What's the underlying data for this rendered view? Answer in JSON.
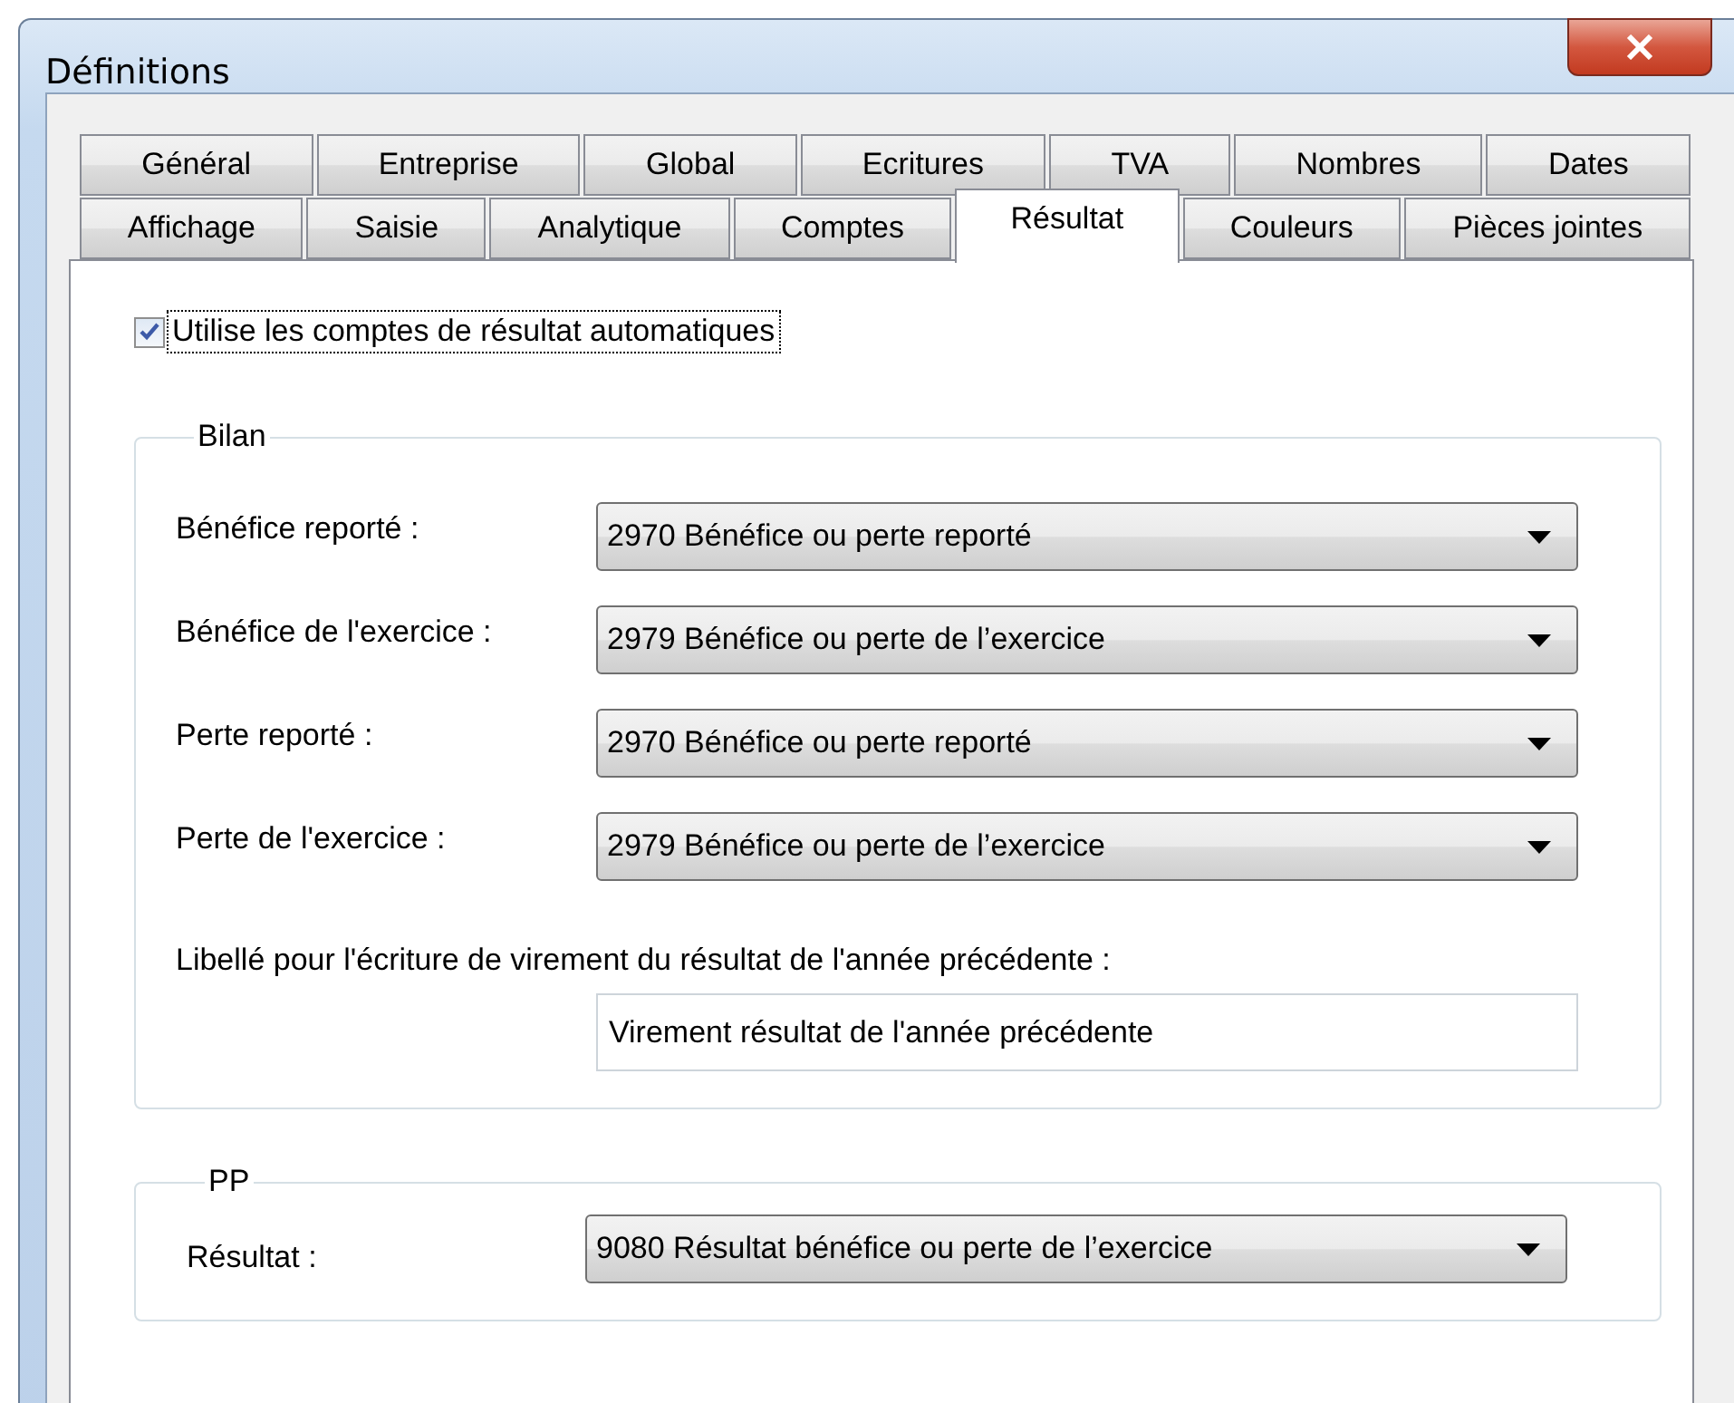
{
  "window": {
    "title": "Définitions"
  },
  "tab_rows": [
    {
      "tabs": [
        {
          "label": "Général",
          "selected": false
        },
        {
          "label": "Entreprise",
          "selected": false
        },
        {
          "label": "Global",
          "selected": false
        },
        {
          "label": "Ecritures",
          "selected": false
        },
        {
          "label": "TVA",
          "selected": false
        },
        {
          "label": "Nombres",
          "selected": false
        },
        {
          "label": "Dates",
          "selected": false
        }
      ]
    },
    {
      "tabs": [
        {
          "label": "Affichage",
          "selected": false
        },
        {
          "label": "Saisie",
          "selected": false
        },
        {
          "label": "Analytique",
          "selected": false
        },
        {
          "label": "Comptes",
          "selected": false
        },
        {
          "label": "Résultat",
          "selected": true
        },
        {
          "label": "Couleurs",
          "selected": false
        },
        {
          "label": "Pièces jointes",
          "selected": false
        }
      ]
    }
  ],
  "auto_accounts": {
    "label": "Utilise les comptes de résultat automatiques",
    "checked": true
  },
  "bilan": {
    "title": "Bilan",
    "fields": [
      {
        "label": "Bénéfice reporté :",
        "value": "2970 Bénéfice ou perte reporté"
      },
      {
        "label": "Bénéfice de l'exercice :",
        "value": "2979 Bénéfice ou perte de l’exercice"
      },
      {
        "label": "Perte reporté :",
        "value": "2970 Bénéfice ou perte reporté"
      },
      {
        "label": "Perte de l'exercice :",
        "value": "2979 Bénéfice ou perte de l’exercice"
      }
    ],
    "transfer": {
      "label": "Libellé pour l'écriture de virement du résultat de l'année précédente :",
      "value": "Virement résultat de l'année précédente"
    }
  },
  "pp": {
    "title": "PP",
    "fields": [
      {
        "label": "Résultat :",
        "value": "9080 Résultat bénéfice ou perte de l’exercice"
      }
    ]
  }
}
